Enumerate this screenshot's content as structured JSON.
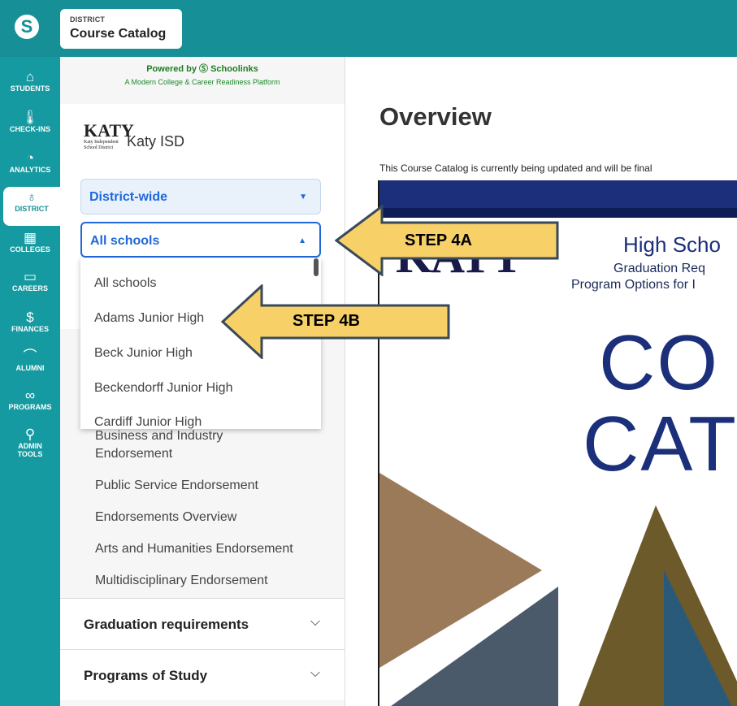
{
  "app": {
    "logo_letter": "S",
    "district_label": "DISTRICT",
    "district_title": "Course Catalog"
  },
  "sidenav": [
    {
      "label": "STUDENTS",
      "icon": "home-icon",
      "glyph": "⌂"
    },
    {
      "label": "CHECK-INS",
      "icon": "thermometer-list-icon",
      "glyph": "🌡"
    },
    {
      "label": "ANALYTICS",
      "icon": "pie-chart-icon",
      "glyph": "◔"
    },
    {
      "label": "DISTRICT",
      "icon": "apple-icon",
      "glyph": "♁"
    },
    {
      "label": "COLLEGES",
      "icon": "building-icon",
      "glyph": "▦"
    },
    {
      "label": "CAREERS",
      "icon": "briefcase-icon",
      "glyph": "▭"
    },
    {
      "label": "FINANCES",
      "icon": "money-bag-icon",
      "glyph": "$"
    },
    {
      "label": "ALUMNI",
      "icon": "graduation-cap-icon",
      "glyph": "⌒"
    },
    {
      "label": "PROGRAMS",
      "icon": "handshake-icon",
      "glyph": "∞"
    },
    {
      "label": "ADMIN TOOLS",
      "icon": "key-icon",
      "glyph": "⚲"
    }
  ],
  "panel": {
    "powered_by": "Powered by",
    "brand": "Schoolinks",
    "tagline": "A Modern College & Career Readiness Platform",
    "district_name": "Katy ISD",
    "logo_text": "KATY",
    "logo_sub": "Katy Independent School District",
    "scope_select": "District-wide",
    "school_select": "All schools",
    "school_options": [
      "All schools",
      "Adams Junior High",
      "Beck Junior High",
      "Beckendorff Junior High",
      "Cardiff Junior High"
    ],
    "endorsements": [
      "Business and Industry",
      "Endorsement",
      "Public Service Endorsement",
      "Endorsements Overview",
      "Arts and Humanities Endorsement",
      "Multidisciplinary Endorsement"
    ],
    "sections": [
      "Graduation requirements",
      "Programs of Study"
    ]
  },
  "main": {
    "heading": "Overview",
    "notice": "This Course Catalog is currently being updated and will be final",
    "cover": {
      "katy": "KATY",
      "title1": "High Scho",
      "title2": "Graduation Req",
      "title3": "Program Options for I",
      "big1": "CO",
      "big2": "CAT"
    }
  },
  "callouts": {
    "step_4a": "STEP 4A",
    "step_4b": "STEP 4B"
  },
  "colors": {
    "teal": "#178f96",
    "accent_blue": "#1f68d9",
    "callout_fill": "#f7d068",
    "navy": "#1b2f7a"
  }
}
